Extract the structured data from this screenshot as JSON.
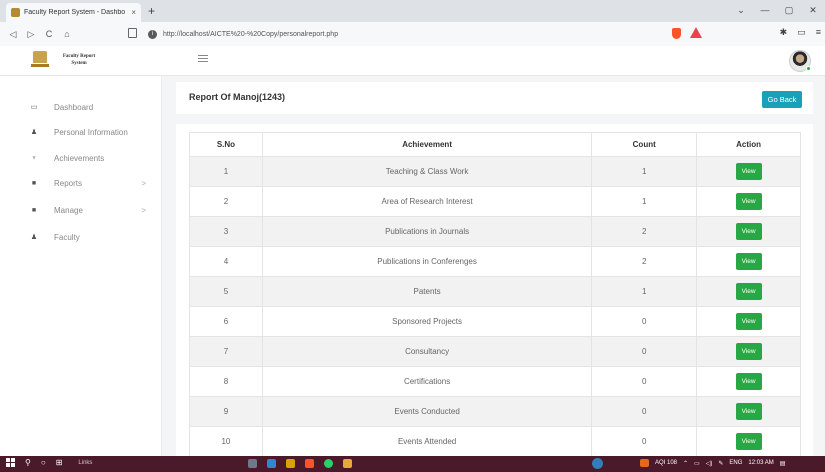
{
  "browser": {
    "tab_title": "Faculty Report System - Dashbo",
    "tab_close": "×",
    "new_tab": "+",
    "url": "http://localhost/AICTE%20-%20Copy/personalreport.php",
    "nav": {
      "back": "◁",
      "forward": "▷",
      "reload": "C",
      "home": "⌂"
    },
    "window_controls": {
      "minimize": "—",
      "maximize": "▢",
      "close": "✕",
      "dropdown": "⌄"
    }
  },
  "app": {
    "brand": "Faculty Report System",
    "sidebar": {
      "items": [
        {
          "label": "Dashboard",
          "icon": "monitor-icon",
          "glyph": "▭",
          "has_children": false
        },
        {
          "label": "Personal Information",
          "icon": "user-icon",
          "glyph": "♟",
          "has_children": false
        },
        {
          "label": "Achievements",
          "icon": "trophy-icon",
          "glyph": "♆",
          "has_children": false
        },
        {
          "label": "Reports",
          "icon": "file-icon",
          "glyph": "■",
          "has_children": true
        },
        {
          "label": "Manage",
          "icon": "file-icon",
          "glyph": "■",
          "has_children": true
        },
        {
          "label": "Faculty",
          "icon": "user-icon",
          "glyph": "♟",
          "has_children": false
        }
      ],
      "chevron": ">"
    },
    "report": {
      "title": "Report Of Manoj(1243)",
      "go_back_label": "Go Back",
      "columns": [
        "S.No",
        "Achievement",
        "Count",
        "Action"
      ],
      "rows": [
        {
          "sno": "1",
          "achievement": "Teaching & Class Work",
          "count": "1",
          "action": "View"
        },
        {
          "sno": "2",
          "achievement": "Area of Research Interest",
          "count": "1",
          "action": "View"
        },
        {
          "sno": "3",
          "achievement": "Publications in Journals",
          "count": "2",
          "action": "View"
        },
        {
          "sno": "4",
          "achievement": "Publications in Conferenges",
          "count": "2",
          "action": "View"
        },
        {
          "sno": "5",
          "achievement": "Patents",
          "count": "1",
          "action": "View"
        },
        {
          "sno": "6",
          "achievement": "Sponsored Projects",
          "count": "0",
          "action": "View"
        },
        {
          "sno": "7",
          "achievement": "Consultancy",
          "count": "0",
          "action": "View"
        },
        {
          "sno": "8",
          "achievement": "Certifications",
          "count": "0",
          "action": "View"
        },
        {
          "sno": "9",
          "achievement": "Events Conducted",
          "count": "0",
          "action": "View"
        },
        {
          "sno": "10",
          "achievement": "Events Attended",
          "count": "0",
          "action": "View"
        }
      ]
    }
  },
  "taskbar": {
    "links_label": "Links",
    "aqi": "AQI 108",
    "language": "ENG",
    "time": "12:03 AM"
  },
  "colors": {
    "go_back_bg": "#17a2b8",
    "view_bg": "#28a745",
    "taskbar_bg": "#4a1a2b"
  }
}
